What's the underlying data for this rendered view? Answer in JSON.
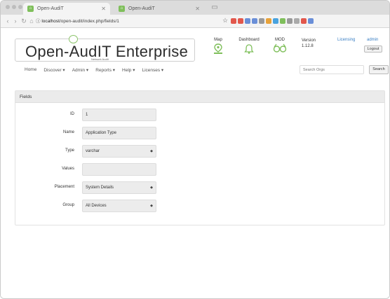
{
  "browser": {
    "tabs": [
      {
        "label": "Open-AudiT",
        "active": true
      },
      {
        "label": "Open-AudiT",
        "active": false
      }
    ],
    "url_prefix": "ⓘ ",
    "url_host": "localhost",
    "url_path": "/open-audit/index.php/fields/1",
    "extension_colors": [
      "#e2574c",
      "#e2574c",
      "#6a8fd8",
      "#6a8fd8",
      "#999999",
      "#e8a23a",
      "#4aa3df",
      "#7fbf5b",
      "#999999",
      "#aaaaaa",
      "#e2574c",
      "#6a8fd8"
    ]
  },
  "header": {
    "logo_text": "Open-AudIT Enterprise",
    "logo_subtitle": "Network Audit",
    "items": [
      {
        "label": "Map",
        "icon": "map-pin-icon"
      },
      {
        "label": "Dashboard",
        "icon": "bell-icon"
      },
      {
        "label": "MOD",
        "icon": "glasses-icon"
      }
    ],
    "version_label": "Version",
    "version_value": "1.12.8",
    "license_link": "Licensing",
    "user_link": "admin",
    "logout_label": "Logout"
  },
  "nav": {
    "menu": [
      "Home",
      "Discover ▾",
      "Admin ▾",
      "Reports ▾",
      "Help ▾",
      "Licenses ▾"
    ],
    "search_placeholder": "Search Orgs",
    "search_button": "Search"
  },
  "panel": {
    "title": "Fields",
    "rows": [
      {
        "label": "ID",
        "value": "1",
        "type": "text"
      },
      {
        "label": "Name",
        "value": "Application Type",
        "type": "text"
      },
      {
        "label": "Type",
        "value": "varchar",
        "type": "select"
      },
      {
        "label": "Values",
        "value": "",
        "type": "text"
      },
      {
        "label": "Placement",
        "value": "System Details",
        "type": "select"
      },
      {
        "label": "Group",
        "value": "All Devices",
        "type": "select"
      }
    ]
  },
  "colors": {
    "accent_green": "#7fbf5b",
    "link_blue": "#3a7fc4"
  }
}
